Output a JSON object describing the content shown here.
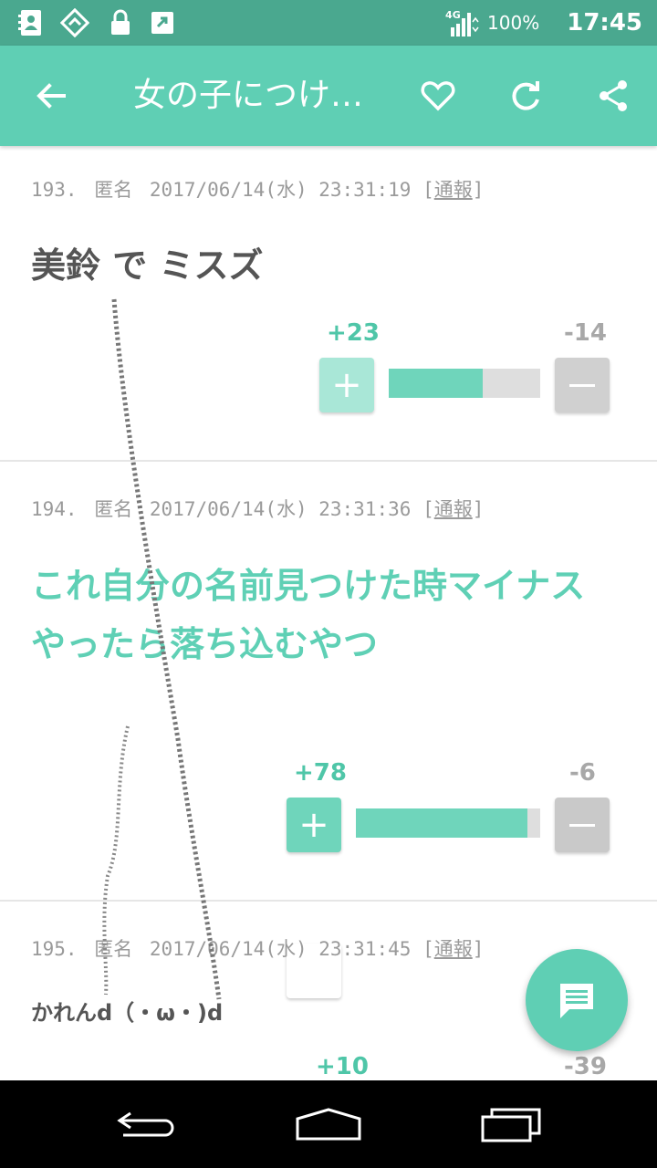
{
  "status_bar": {
    "network": "4G",
    "battery": "100%",
    "time": "17:45"
  },
  "app_bar": {
    "title": "女の子につけ…"
  },
  "posts": [
    {
      "number": "193.",
      "author": "匿名",
      "datetime": "2017/06/14(水) 23:31:19",
      "report_open": "[",
      "report": "通報",
      "report_close": "]",
      "text": "美鈴 で ミスズ",
      "plus": "+23",
      "minus": "-14",
      "ratio": 0.62
    },
    {
      "number": "194.",
      "author": "匿名",
      "datetime": "2017/06/14(水) 23:31:36",
      "report_open": "[",
      "report": "通報",
      "report_close": "]",
      "text_line1": "これ自分の名前見つけた時マイナス",
      "text_line2": "やったら落ち込むやつ",
      "text_color": "#5fd0b5",
      "plus": "+78",
      "minus": "-6",
      "ratio": 0.93
    },
    {
      "number": "195.",
      "author": "匿名",
      "datetime": "2017/06/14(水) 23:31:45",
      "report_open": "[",
      "report": "通報",
      "report_close": "]",
      "text": "かれんd（・ω・)d",
      "plus": "+10",
      "minus": "-39"
    }
  ],
  "colors": {
    "accent": "#5fcfb4",
    "status_bar": "#4aa88f"
  }
}
